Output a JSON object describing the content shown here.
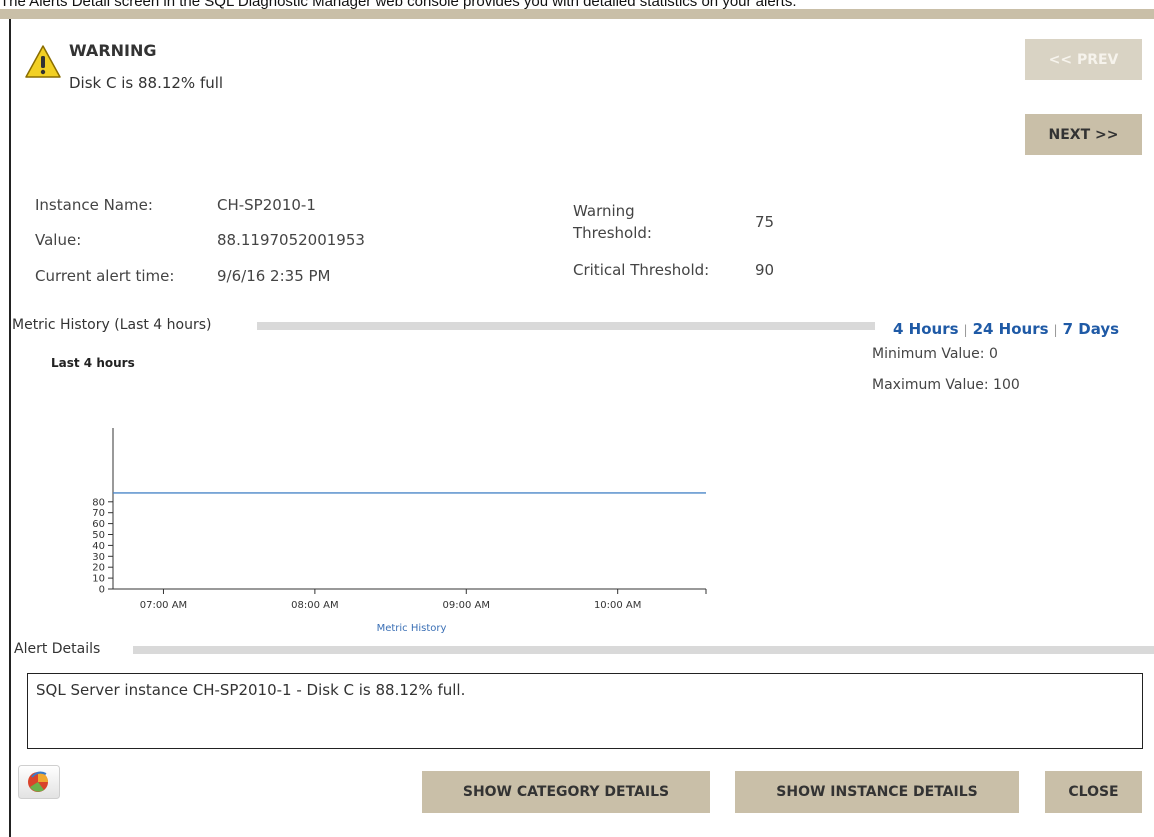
{
  "caption": "The Alerts Detail screen in the SQL Diagnostic Manager web console provides you with detailed statistics on your alerts.",
  "alert": {
    "severity": "WARNING",
    "message": "Disk C is 88.12% full",
    "icon": "warning-triangle-icon"
  },
  "nav": {
    "prev_label": "<< PREV",
    "next_label": "NEXT >>"
  },
  "info": {
    "instance_label": "Instance Name:",
    "instance_value": "CH-SP2010-1",
    "value_label": "Value:",
    "value_value": "88.1197052001953",
    "time_label": "Current alert time:",
    "time_value": "9/6/16 2:35 PM",
    "warning_label_1": "Warning",
    "warning_label_2": "Threshold:",
    "warning_value": "75",
    "critical_label": "Critical Threshold:",
    "critical_value": "90"
  },
  "metric_history": {
    "section_title": "Metric History (Last 4 hours)",
    "ranges": [
      "4 Hours",
      "24 Hours",
      "7 Days"
    ],
    "min_label": "Minimum Value:",
    "min_value": "0",
    "max_label": "Maximum Value:",
    "max_value": "100"
  },
  "chart_data": {
    "type": "line",
    "title": "Last 4 hours",
    "xlabel": "Metric History",
    "ylabel": "",
    "x_ticks": [
      "07:00 AM",
      "08:00 AM",
      "09:00 AM",
      "10:00 AM"
    ],
    "y_ticks": [
      0,
      10,
      20,
      30,
      40,
      50,
      60,
      70,
      80
    ],
    "ylim": [
      0,
      88
    ],
    "x": [
      "06:40 AM",
      "10:35 AM"
    ],
    "series": [
      {
        "values": [
          88.12,
          88.12
        ]
      }
    ],
    "line_color": "#4a86c8",
    "grid": false
  },
  "alert_details": {
    "section_title": "Alert Details",
    "text": "SQL Server instance CH-SP2010-1 - Disk C is 88.12% full."
  },
  "actions": {
    "category_label": "SHOW CATEGORY DETAILS",
    "instance_label": "SHOW INSTANCE DETAILS",
    "close_label": "CLOSE"
  },
  "colors": {
    "button_bg": "#c9bfa8",
    "link": "#1f5aa6",
    "warning": "#f2d024"
  }
}
